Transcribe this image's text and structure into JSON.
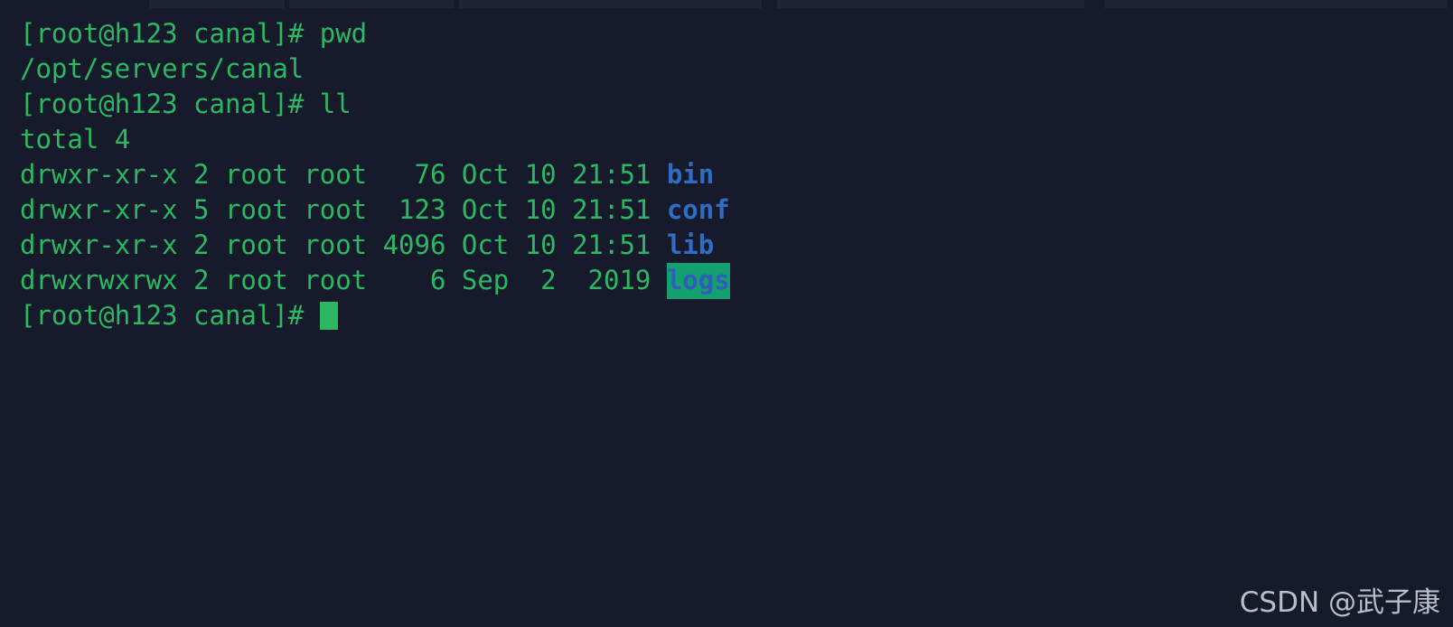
{
  "window": {
    "background_color": "#161a2b",
    "foreground_color": "#2cb862",
    "directory_color": "#2f6cc4",
    "highlight_background_color": "#14a06e",
    "tab_ghost_color": "#1e2335"
  },
  "terminal": {
    "prompt": "[root@h123 canal]#",
    "lines": [
      {
        "id": "line-1-prompt-pwd",
        "type": "prompt",
        "text": "[root@h123 canal]# pwd"
      },
      {
        "id": "line-2-output-cwd",
        "type": "output",
        "text": "/opt/servers/canal"
      },
      {
        "id": "line-3-prompt-ll",
        "type": "prompt",
        "text": "[root@h123 canal]# ll"
      },
      {
        "id": "line-4-total",
        "type": "output",
        "text": "total 4"
      },
      {
        "id": "line-5-bin",
        "type": "listing",
        "prefix": "drwxr-xr-x 2 root root   76 Oct 10 21:51 ",
        "permissions": "drwxr-xr-x",
        "links": "2",
        "owner": "root",
        "group": "root",
        "size": "76",
        "month": "Oct",
        "day": "10",
        "time": "21:51",
        "name": "bin",
        "highlighted": false
      },
      {
        "id": "line-6-conf",
        "type": "listing",
        "prefix": "drwxr-xr-x 5 root root  123 Oct 10 21:51 ",
        "permissions": "drwxr-xr-x",
        "links": "5",
        "owner": "root",
        "group": "root",
        "size": "123",
        "month": "Oct",
        "day": "10",
        "time": "21:51",
        "name": "conf",
        "highlighted": false
      },
      {
        "id": "line-7-lib",
        "type": "listing",
        "prefix": "drwxr-xr-x 2 root root 4096 Oct 10 21:51 ",
        "permissions": "drwxr-xr-x",
        "links": "2",
        "owner": "root",
        "group": "root",
        "size": "4096",
        "month": "Oct",
        "day": "10",
        "time": "21:51",
        "name": "lib",
        "highlighted": false
      },
      {
        "id": "line-8-logs",
        "type": "listing",
        "prefix": "drwxrwxrwx 2 root root    6 Sep  2  2019 ",
        "permissions": "drwxrwxrwx",
        "links": "2",
        "owner": "root",
        "group": "root",
        "size": "6",
        "month": "Sep",
        "day": "2",
        "time": "2019",
        "name": "logs",
        "highlighted": true
      },
      {
        "id": "line-9-prompt-cursor",
        "type": "prompt_cursor",
        "text": "[root@h123 canal]# "
      }
    ]
  },
  "watermark": {
    "text": "CSDN @武子康"
  }
}
